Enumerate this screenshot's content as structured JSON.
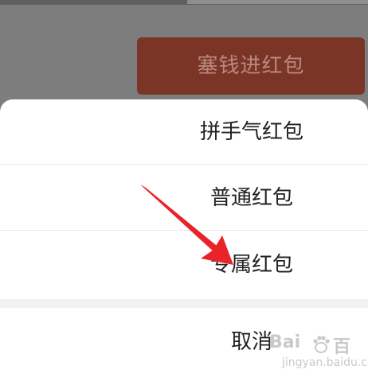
{
  "background_button": {
    "label": "塞钱进红包"
  },
  "sheet": {
    "options": [
      {
        "label": "拼手气红包"
      },
      {
        "label": "普通红包"
      },
      {
        "label": "专属红包"
      }
    ],
    "cancel_label": "取消"
  },
  "watermark": {
    "brand_left": "Bai",
    "brand_right": "百",
    "sub": "jingyan.baidu.com"
  },
  "colors": {
    "overlay": "#7d7d7d",
    "button_bg": "#7a3527",
    "button_text": "#b9897e",
    "arrow": "#e8242a",
    "sheet_bg": "#ffffff",
    "text": "#222222"
  },
  "icons": {
    "annotation": "red-arrow-icon",
    "watermark": "paw-icon"
  }
}
